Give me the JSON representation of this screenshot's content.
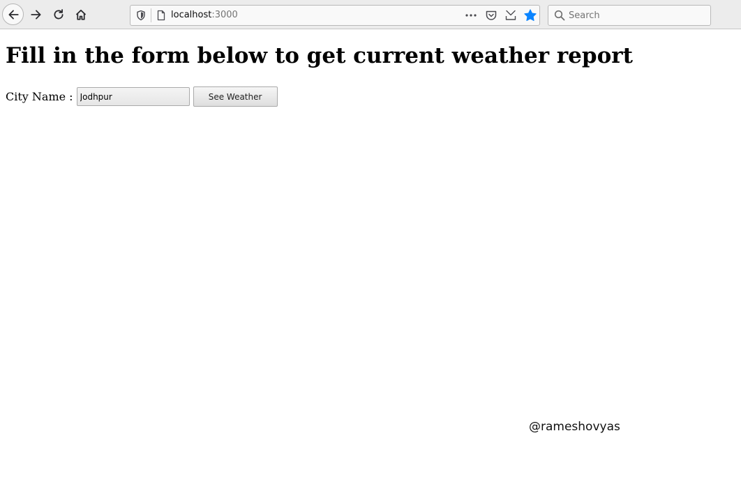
{
  "browser": {
    "url_host": "localhost",
    "url_port": ":3000",
    "search_placeholder": "Search"
  },
  "icons": {
    "back": "back-arrow-icon",
    "forward": "forward-arrow-icon",
    "reload": "reload-icon",
    "home": "home-icon",
    "tracking": "shield-icon",
    "page": "page-icon",
    "actions": "page-actions-icon",
    "pocket": "pocket-icon",
    "download": "download-icon",
    "bookmark": "star-icon",
    "search": "search-icon"
  },
  "colors": {
    "bookmark_star": "#0a84ff"
  },
  "page": {
    "heading": "Fill in the form below to get current weather report",
    "city_label": "City Name :",
    "city_value": "Jodhpur",
    "submit_label": "See Weather"
  },
  "watermark": "@rameshovyas"
}
